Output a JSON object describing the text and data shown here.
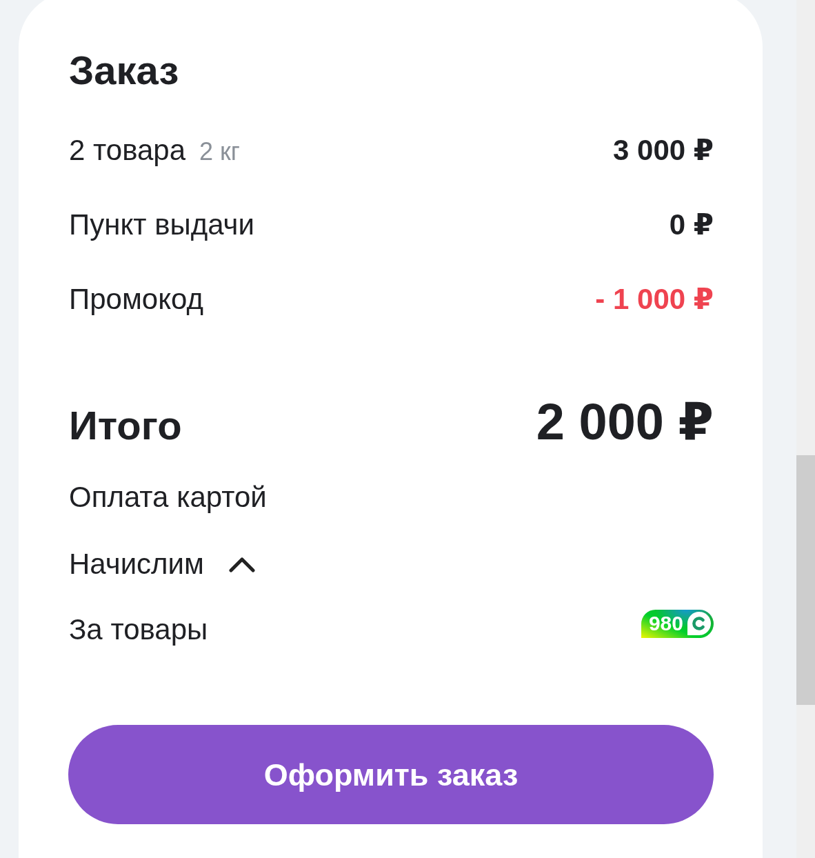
{
  "title": "Заказ",
  "lines": [
    {
      "kind": "charge",
      "label": "2 товара",
      "note": "2 кг",
      "amount": "3 000 ₽"
    },
    {
      "kind": "charge",
      "label": "Пункт выдачи",
      "amount": "0 ₽"
    },
    {
      "kind": "discount",
      "label": "Промокод",
      "amount": "- 1 000 ₽"
    }
  ],
  "total": {
    "label": "Итого",
    "amount": "2 000 ₽"
  },
  "payment_method": "Оплата картой",
  "bonus": {
    "label": "Начислим",
    "expanded": true,
    "items": [
      {
        "label": "За товары",
        "points": "980"
      }
    ]
  },
  "checkout_button": "Оформить заказ"
}
